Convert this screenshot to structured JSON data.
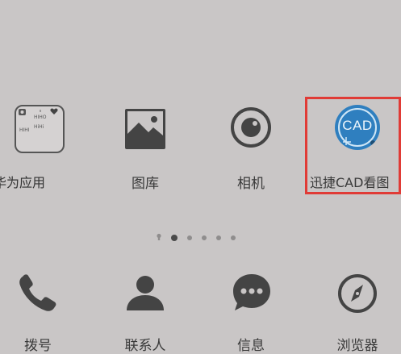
{
  "home": {
    "apps": [
      {
        "label": "华为应用",
        "icon": "folder-icon"
      },
      {
        "label": "图库",
        "icon": "gallery-icon"
      },
      {
        "label": "相机",
        "icon": "camera-icon"
      },
      {
        "label": "迅捷CAD看图",
        "icon": "cad-viewer-icon",
        "icon_text": "CAD",
        "highlighted": true
      }
    ],
    "folder_mini_text": [
      "HIHO",
      "HiHi",
      "HIHI"
    ],
    "page_indicator": {
      "pages": 5,
      "current": 2
    }
  },
  "dock": {
    "apps": [
      {
        "label": "拨号",
        "icon": "phone-icon"
      },
      {
        "label": "联系人",
        "icon": "contacts-icon"
      },
      {
        "label": "信息",
        "icon": "messages-icon"
      },
      {
        "label": "浏览器",
        "icon": "browser-icon"
      }
    ]
  },
  "colors": {
    "background": "#c9c6c6",
    "icon": "#444444",
    "cad_blue": "#2f7fbf",
    "highlight_red": "#e03b36"
  }
}
